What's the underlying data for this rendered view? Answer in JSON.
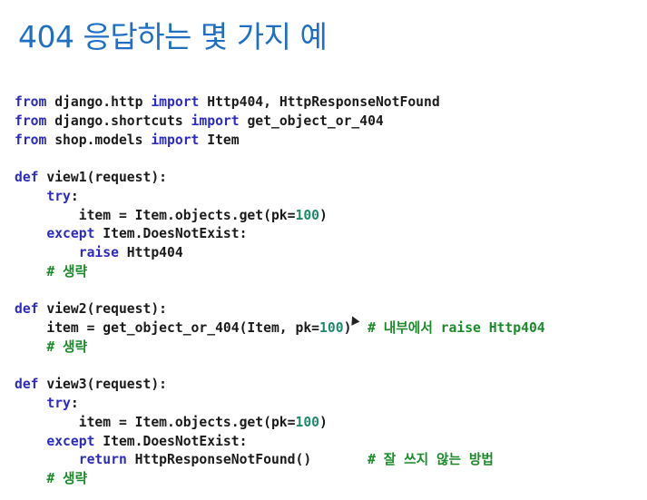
{
  "title": "404 응답하는 몇 가지 예",
  "code": [
    [
      {
        "t": "from",
        "c": "kw"
      },
      {
        "t": " django.http "
      },
      {
        "t": "import",
        "c": "kw"
      },
      {
        "t": " Http404, HttpResponseNotFound"
      }
    ],
    [
      {
        "t": "from",
        "c": "kw"
      },
      {
        "t": " django.shortcuts "
      },
      {
        "t": "import",
        "c": "kw"
      },
      {
        "t": " get_object_or_404"
      }
    ],
    [
      {
        "t": "from",
        "c": "kw"
      },
      {
        "t": " shop.models "
      },
      {
        "t": "import",
        "c": "kw"
      },
      {
        "t": " Item"
      }
    ],
    [],
    [
      {
        "t": "def",
        "c": "kw"
      },
      {
        "t": " view1(request):"
      }
    ],
    [
      {
        "t": "    "
      },
      {
        "t": "try",
        "c": "kw"
      },
      {
        "t": ":"
      }
    ],
    [
      {
        "t": "        item = Item.objects.get(pk="
      },
      {
        "t": "100",
        "c": "num"
      },
      {
        "t": ")"
      }
    ],
    [
      {
        "t": "    "
      },
      {
        "t": "except",
        "c": "kw"
      },
      {
        "t": " Item.DoesNotExist:"
      }
    ],
    [
      {
        "t": "        "
      },
      {
        "t": "raise",
        "c": "kw"
      },
      {
        "t": " Http404"
      }
    ],
    [
      {
        "t": "    "
      },
      {
        "t": "# 생략",
        "c": "cm"
      }
    ],
    [],
    [
      {
        "t": "def",
        "c": "kw"
      },
      {
        "t": " view2(request):"
      }
    ],
    [
      {
        "t": "    item = get_object_or_404(Item, pk="
      },
      {
        "t": "100",
        "c": "num"
      },
      {
        "t": ")  "
      },
      {
        "t": "# 내부에서 raise Http404",
        "c": "cm"
      }
    ],
    [
      {
        "t": "    "
      },
      {
        "t": "# 생략",
        "c": "cm"
      }
    ],
    [],
    [
      {
        "t": "def",
        "c": "kw"
      },
      {
        "t": " view3(request):"
      }
    ],
    [
      {
        "t": "    "
      },
      {
        "t": "try",
        "c": "kw"
      },
      {
        "t": ":"
      }
    ],
    [
      {
        "t": "        item = Item.objects.get(pk="
      },
      {
        "t": "100",
        "c": "num"
      },
      {
        "t": ")"
      }
    ],
    [
      {
        "t": "    "
      },
      {
        "t": "except",
        "c": "kw"
      },
      {
        "t": " Item.DoesNotExist:"
      }
    ],
    [
      {
        "t": "        "
      },
      {
        "t": "return",
        "c": "kw"
      },
      {
        "t": " HttpResponseNotFound()       "
      },
      {
        "t": "# 잘 쓰지 않는 방법",
        "c": "cm"
      }
    ],
    [
      {
        "t": "    "
      },
      {
        "t": "# 생략",
        "c": "cm"
      }
    ]
  ]
}
